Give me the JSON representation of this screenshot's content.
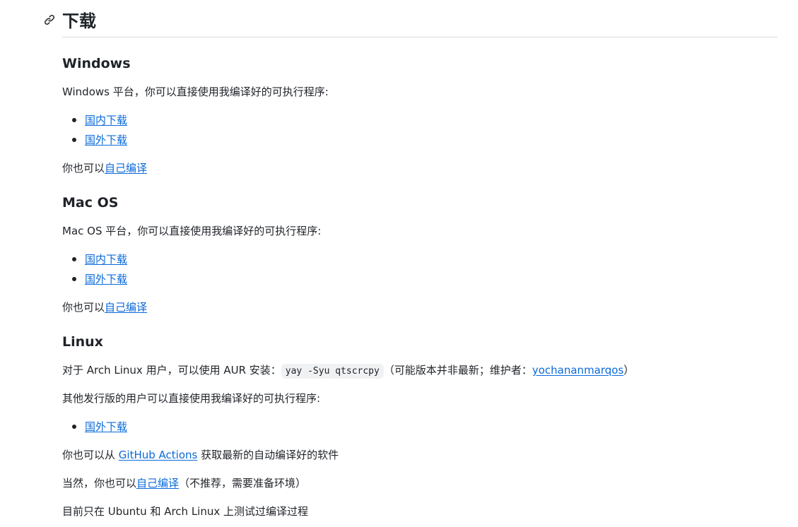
{
  "heading": {
    "title": "下载",
    "anchor_icon": "link-icon"
  },
  "windows": {
    "title": "Windows",
    "intro": "Windows 平台，你可以直接使用我编译好的可执行程序:",
    "links": [
      "国内下载",
      "国外下载"
    ],
    "build_prefix": "你也可以",
    "build_link": "自己编译"
  },
  "macos": {
    "title": "Mac OS",
    "intro": "Mac OS 平台，你可以直接使用我编译好的可执行程序:",
    "links": [
      "国内下载",
      "国外下载"
    ],
    "build_prefix": "你也可以",
    "build_link": "自己编译"
  },
  "linux": {
    "title": "Linux",
    "aur_prefix": "对于 Arch Linux 用户，可以使用 AUR 安装：",
    "aur_command": "yay -Syu qtscrcpy",
    "aur_note_prefix": "（可能版本并非最新；维护者：",
    "maintainer": "yochananmarqos",
    "aur_note_suffix": "）",
    "other_intro": "其他发行版的用户可以直接使用我编译好的可执行程序:",
    "links": [
      "国外下载"
    ],
    "actions_prefix": "你也可以从 ",
    "actions_link": "GitHub Actions",
    "actions_suffix": " 获取最新的自动编译好的软件",
    "build_prefix": "当然，你也可以",
    "build_link": "自己编译",
    "build_suffix": "（不推荐，需要准备环境）",
    "tested": "目前只在 Ubuntu 和 Arch Linux 上测试过编译过程"
  }
}
